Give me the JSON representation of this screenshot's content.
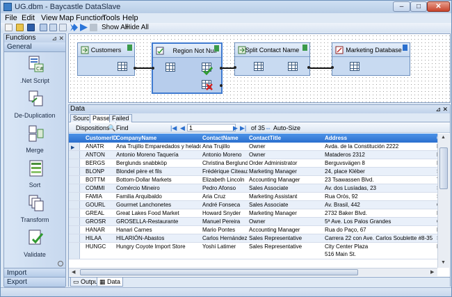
{
  "window": {
    "title": "UG.dbm - Baycastle DataSlave"
  },
  "menu": [
    {
      "label": "File"
    },
    {
      "label": "Edit"
    },
    {
      "label": "View"
    },
    {
      "label": "Map"
    },
    {
      "label": "Function"
    },
    {
      "label": "Tools"
    },
    {
      "label": "Help"
    }
  ],
  "toolbar": {
    "show_all": "Show All",
    "hide_all": "Hide All"
  },
  "functions_panel": {
    "title": "Functions",
    "group_general": "General",
    "tools": [
      {
        "label": ".Net Script",
        "icon": "net-script-icon"
      },
      {
        "label": "De-Duplication",
        "icon": "deduplication-icon"
      },
      {
        "label": "Merge",
        "icon": "merge-icon"
      },
      {
        "label": "Sort",
        "icon": "sort-icon"
      },
      {
        "label": "Transform",
        "icon": "transform-icon"
      },
      {
        "label": "Validate",
        "icon": "validate-icon"
      }
    ],
    "group_import": "Import",
    "group_export": "Export"
  },
  "canvas": {
    "nodes": [
      {
        "label": "Customers"
      },
      {
        "label": "Region Not Null"
      },
      {
        "label": "Split Contact Name"
      },
      {
        "label": "Marketing Database"
      }
    ]
  },
  "data_panel": {
    "title": "Data",
    "tabs": [
      {
        "label": "Source"
      },
      {
        "label": "Passed"
      },
      {
        "label": "Failed"
      }
    ],
    "active_tab": "Passed",
    "dispositions": "Dispositions",
    "find": "Find",
    "page": "1",
    "page_total": "of 35",
    "auto_size": "Auto-Size",
    "columns": [
      "CustomerID",
      "CompanyName",
      "ContactName",
      "ContactTitle",
      "Address",
      "C"
    ],
    "rows": [
      [
        "ANATR",
        "Ana Trujillo Emparedados y helados",
        "Ana Trujillo",
        "Owner",
        "Avda. de la Constitución 2222",
        "M"
      ],
      [
        "ANTON",
        "Antonio Moreno Taquería",
        "Antonio Moreno",
        "Owner",
        "Mataderos  2312",
        "M"
      ],
      [
        "BERGS",
        "Berglunds snabbköp",
        "Christina Berglund",
        "Order Administrator",
        "Berguvsvägen  8",
        "L"
      ],
      [
        "BLONP",
        "Blondel père et fils",
        "Frédérique Citeaux",
        "Marketing Manager",
        "24, place Kléber",
        "S"
      ],
      [
        "BOTTM",
        "Bottom-Dollar Markets",
        "Elizabeth Lincoln",
        "Accounting Manager",
        "23 Tsawassen Blvd.",
        "T"
      ],
      [
        "COMMI",
        "Comércio Mineiro",
        "Pedro Afonso",
        "Sales Associate",
        "Av. dos Lusíadas, 23",
        "S"
      ],
      [
        "FAMIA",
        "Familia Arquibaldo",
        "Aria Cruz",
        "Marketing Assistant",
        "Rua Orós, 92",
        "S"
      ],
      [
        "GOURL",
        "Gourmet Lanchonetes",
        "André Fonseca",
        "Sales Associate",
        "Av. Brasil, 442",
        "C"
      ],
      [
        "GREAL",
        "Great Lakes Food Market",
        "Howard Snyder",
        "Marketing Manager",
        "2732 Baker Blvd.",
        "E"
      ],
      [
        "GROSR",
        "GROSELLA-Restaurante",
        "Manuel Pereira",
        "Owner",
        "5ª Ave. Los Palos Grandes",
        "C"
      ],
      [
        "HANAR",
        "Hanari Carnes",
        "Mario Pontes",
        "Accounting Manager",
        "Rua do Paço, 67",
        "R"
      ],
      [
        "HILAA",
        "HILARIÓN-Abastos",
        "Carlos Hernández",
        "Sales Representative",
        "Carrera 22 con Ave. Carlos Soublette #8-35",
        "S"
      ],
      [
        "HUNGC",
        "Hungry Coyote Import Store",
        "Yoshi Latimer",
        "Sales Representative",
        "City Center Plaza\n516 Main St.",
        "E"
      ]
    ],
    "bottom_tabs": [
      {
        "label": "Output"
      },
      {
        "label": "Data"
      }
    ]
  },
  "colors": {
    "accent": "#2a6fce",
    "panel": "#dfe9f5",
    "node": "#c8daf1"
  }
}
